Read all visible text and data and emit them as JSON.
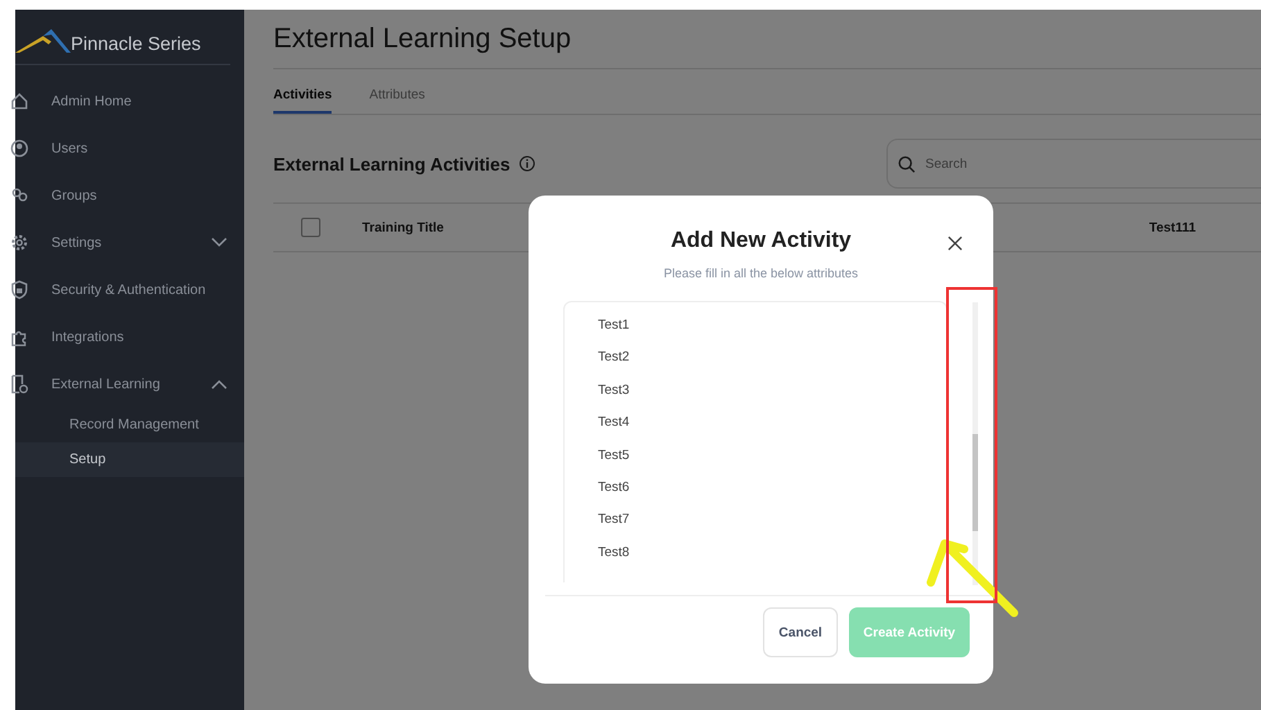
{
  "sidebar": {
    "brand": "Pinnacle Series",
    "items": [
      {
        "label": "Admin Home"
      },
      {
        "label": "Users"
      },
      {
        "label": "Groups"
      },
      {
        "label": "Settings",
        "expanded": false
      },
      {
        "label": "Security & Authentication"
      },
      {
        "label": "Integrations"
      },
      {
        "label": "External Learning",
        "expanded": true,
        "children": [
          {
            "label": "Record Management",
            "selected": false
          },
          {
            "label": "Setup",
            "selected": true
          }
        ]
      }
    ]
  },
  "page": {
    "title": "External Learning Setup",
    "tabs": [
      {
        "label": "Activities",
        "selected": true
      },
      {
        "label": "Attributes",
        "selected": false
      }
    ],
    "section_title": "External Learning Activities",
    "search": {
      "placeholder": "Search"
    },
    "table": {
      "select_all_checked": false,
      "columns": [
        "Training Title",
        "Test111"
      ]
    }
  },
  "dialog": {
    "title": "Add New Activity",
    "subtitle": "Please fill in all the below attributes",
    "items": [
      "Test1",
      "Test2",
      "Test3",
      "Test4",
      "Test5",
      "Test6",
      "Test7",
      "Test8"
    ],
    "buttons": [
      {
        "label": "Cancel",
        "kind": "secondary",
        "disabled": false
      },
      {
        "label": "Create Activity",
        "kind": "primary",
        "disabled": true
      }
    ]
  }
}
